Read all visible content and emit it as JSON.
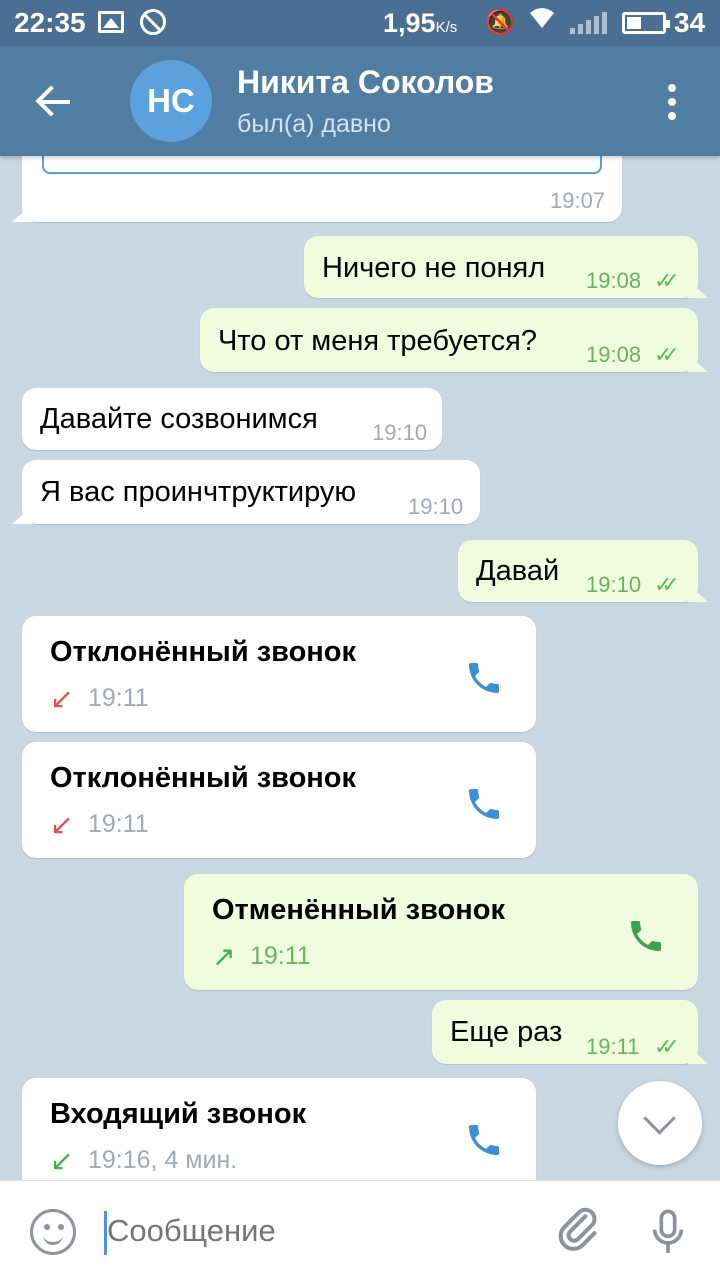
{
  "status_bar": {
    "time": "22:35",
    "speed": "1,95",
    "speed_unit": "K/s",
    "battery": "34"
  },
  "header": {
    "avatar_initials": "НС",
    "contact_name": "Никита Соколов",
    "contact_status": "был(а) давно"
  },
  "messages": [
    {
      "type": "in",
      "time": "19:07"
    },
    {
      "type": "out",
      "text": "Ничего не понял",
      "time": "19:08"
    },
    {
      "type": "out",
      "text": "Что от меня требуется?",
      "time": "19:08"
    },
    {
      "type": "in",
      "text": "Давайте созвонимся",
      "time": "19:10"
    },
    {
      "type": "in",
      "text": "Я вас проинчтруктирую",
      "time": "19:10"
    },
    {
      "type": "out",
      "text": "Давай",
      "time": "19:10"
    },
    {
      "type": "call-in",
      "title": "Отклонённый звонок",
      "time": "19:11"
    },
    {
      "type": "call-in",
      "title": "Отклонённый звонок",
      "time": "19:11"
    },
    {
      "type": "call-out",
      "title": "Отменённый звонок",
      "time": "19:11"
    },
    {
      "type": "out",
      "text": "Еще раз",
      "time": "19:11"
    },
    {
      "type": "call-in",
      "title": "Входящий звонок",
      "time": "19:16, 4 мин."
    }
  ],
  "composer": {
    "placeholder": "Сообщение"
  },
  "colors": {
    "header_bg": "#527da3",
    "statusbar_bg": "#4a6f93",
    "chat_bg": "#c9d7e2",
    "out_bubble": "#effdde",
    "in_bubble": "#ffffff",
    "accent_blue": "#3d8fd4",
    "missed_red": "#e0514f",
    "call_green": "#3fb04b"
  },
  "icons": [
    "back-arrow-icon",
    "more-vert-icon",
    "phone-icon",
    "missed-arrow-icon",
    "outgoing-arrow-icon",
    "incoming-arrow-icon",
    "double-check-icon",
    "emoji-icon",
    "attach-icon",
    "mic-icon",
    "chevron-down-icon"
  ]
}
